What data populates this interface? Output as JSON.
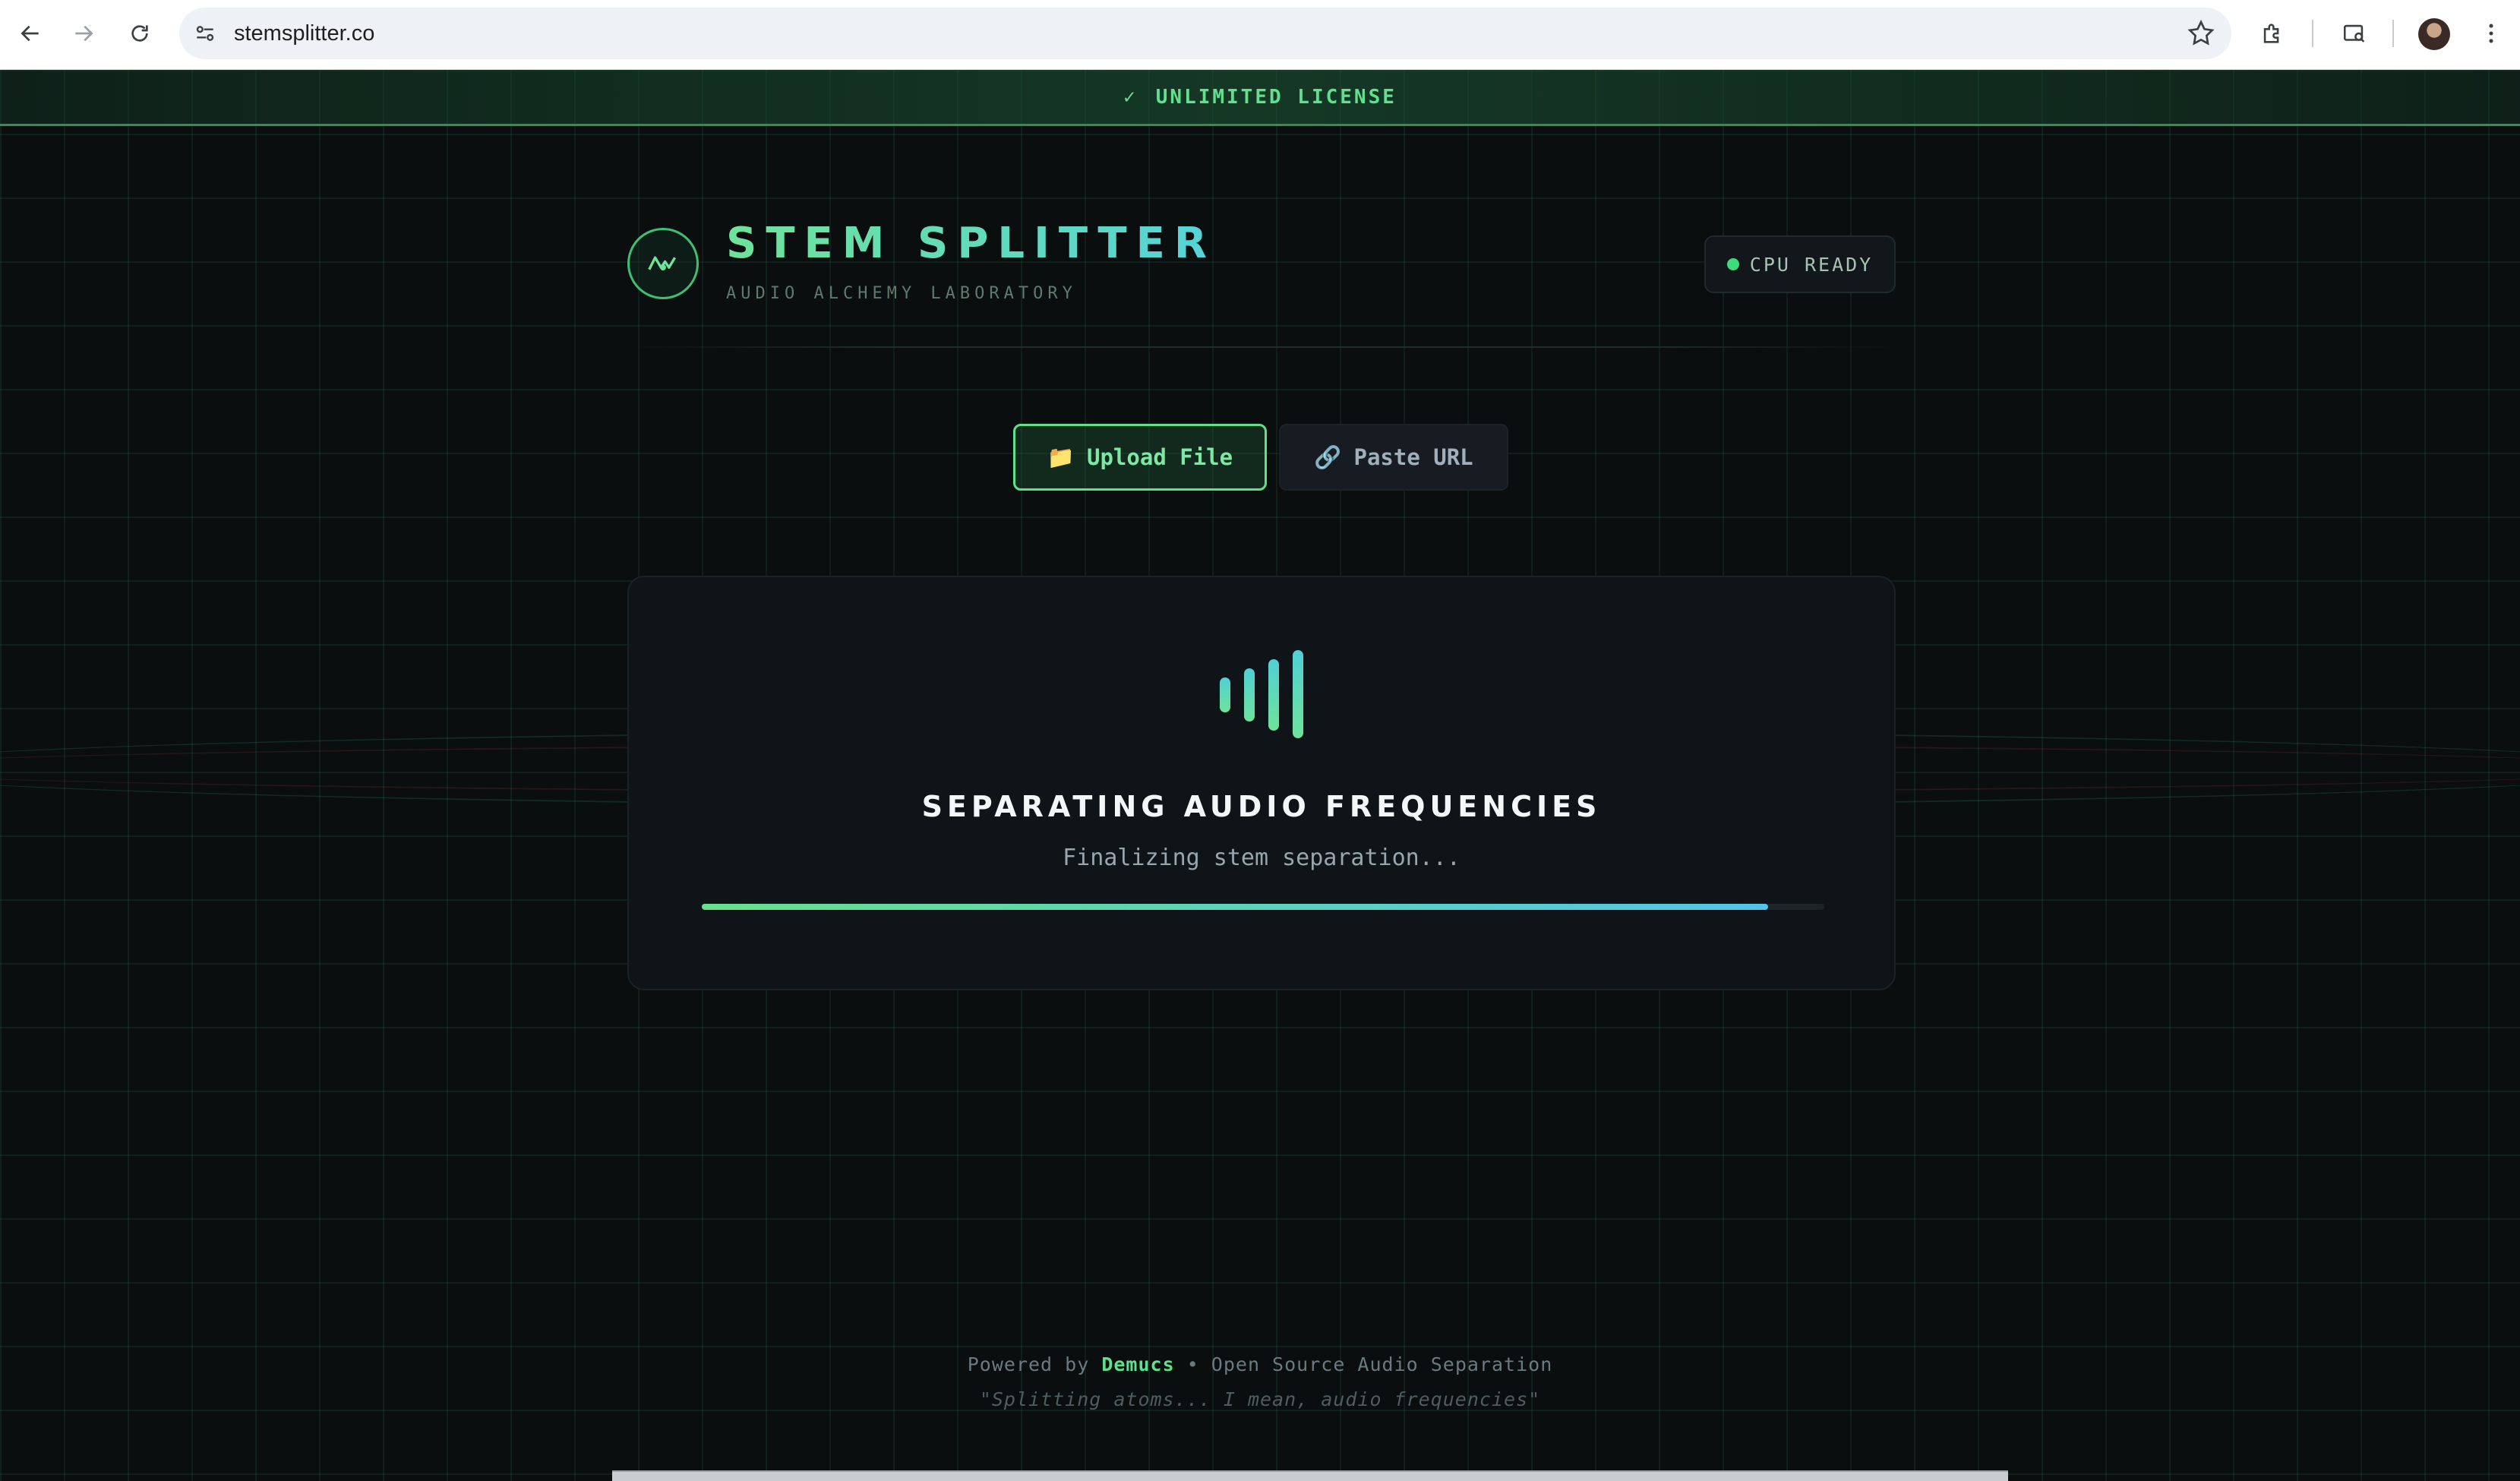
{
  "browser": {
    "url": "stemsplitter.co"
  },
  "banner": {
    "check": "✓",
    "text": "UNLIMITED LICENSE"
  },
  "header": {
    "title": "STEM SPLITTER",
    "subtitle": "AUDIO ALCHEMY LABORATORY",
    "status_badge": "CPU READY"
  },
  "tabs": {
    "upload": {
      "icon": "📁",
      "label": "Upload File"
    },
    "url": {
      "icon": "🔗",
      "label": "Paste URL"
    }
  },
  "processing": {
    "title": "SEPARATING AUDIO FREQUENCIES",
    "status": "Finalizing stem separation...",
    "progress": 0.95
  },
  "footer": {
    "powered_prefix": "Powered by",
    "powered_name": "Demucs",
    "powered_suffix": "• Open Source Audio Separation",
    "quote": "\"Splitting atoms... I mean, audio frequencies\""
  },
  "colors": {
    "accent_green": "#5fe08c",
    "accent_cyan": "#4fc6e8",
    "background": "#0a0e0f"
  }
}
